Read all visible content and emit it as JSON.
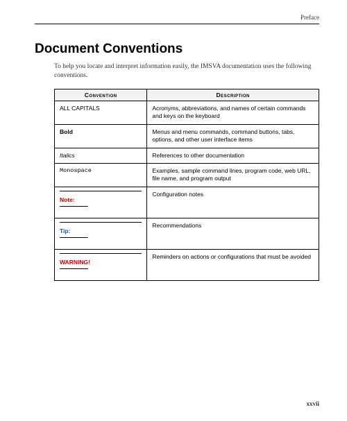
{
  "header": {
    "section": "Preface"
  },
  "title": "Document Conventions",
  "intro": "To help you locate and interpret information easily, the IMSVA documentation uses the following conventions.",
  "table": {
    "headers": {
      "col1": "Convention",
      "col2": "Description"
    },
    "rows": [
      {
        "convention": "ALL CAPITALS",
        "description": "Acronyms, abbreviations, and names of certain commands and keys on the keyboard"
      },
      {
        "convention": "Bold",
        "description": "Menus and menu commands, command buttons, tabs, options, and other user interface items"
      },
      {
        "convention": "Italics",
        "description": "References to other documentation"
      },
      {
        "convention": "Monospace",
        "description": "Examples, sample command lines, program code, web URL, file name, and program output"
      },
      {
        "convention": "Note:",
        "description": "Configuration notes"
      },
      {
        "convention": "Tip:",
        "description": "Recommendations"
      },
      {
        "convention": "WARNING!",
        "description": "Reminders on actions or configurations that must be avoided"
      }
    ]
  },
  "page_number": "xxvii"
}
